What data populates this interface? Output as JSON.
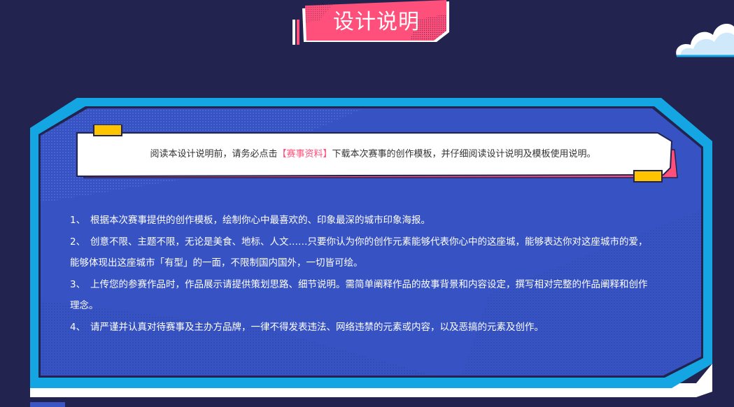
{
  "header": {
    "title": "设计说明"
  },
  "notice": {
    "before": "阅读本设计说明前，请务必点击",
    "link": "【赛事资料】",
    "after": "下载本次赛事的创作模板，并仔细阅读设计说明及模板使用说明。"
  },
  "rules": [
    {
      "num": "1、",
      "text": "根据本次赛事提供的创作模板，绘制你心中最喜欢的、印象最深的城市印象海报。",
      "cont": ""
    },
    {
      "num": "2、",
      "text": "创意不限、主题不限，无论是美食、地标、人文……只要你认为你的创作元素能够代表你心中的这座城，能够表达你对这座城市的爱，",
      "cont": "能够体现出这座城市「有型」的一面，不限制国内国外，一切皆可绘。"
    },
    {
      "num": "3、",
      "text": "上传您的参赛作品时，作品展示请提供策划思路、细节说明。需简单阐释作品的故事背景和内容设定，撰写相对完整的作品阐释和创作",
      "cont": "理念。"
    },
    {
      "num": "4、",
      "text": "请严谨并认真对待赛事及主办方品牌，一律不得发表违法、网络违禁的元素或内容，以及恶搞的元素及创作。",
      "cont": ""
    }
  ],
  "colors": {
    "background": "#23234f",
    "panel": "#3752c2",
    "frame": "#14a6e3",
    "accent_pink": "#ff4f7b",
    "accent_yellow": "#ffc400"
  },
  "icons": {
    "cloud": "cloud-icon"
  }
}
